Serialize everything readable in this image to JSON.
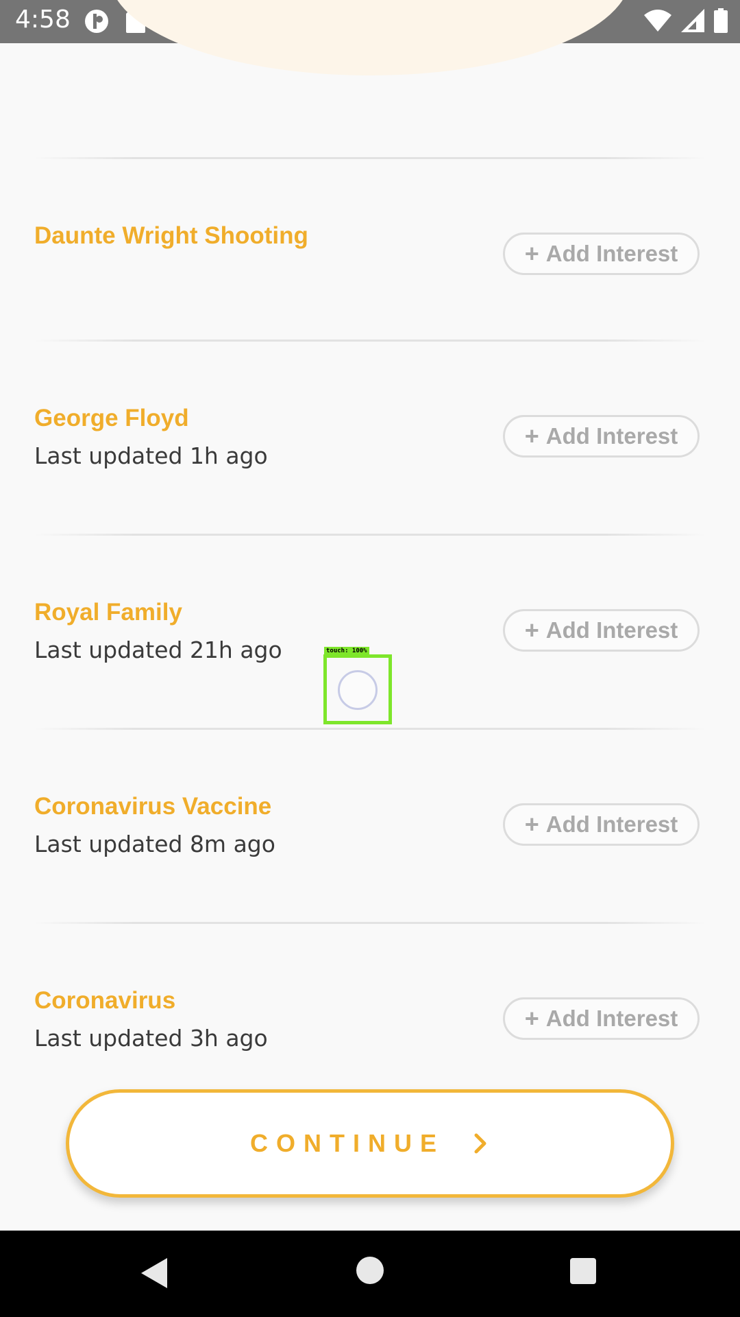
{
  "status_bar": {
    "time": "4:58",
    "icons": [
      "data-saver-icon",
      "sd-card-icon",
      "wifi-icon",
      "signal-icon",
      "battery-icon"
    ]
  },
  "interests": [
    {
      "title": "Daunte Wright Shooting",
      "subtitle": "",
      "button": "Add Interest"
    },
    {
      "title": "George Floyd",
      "subtitle": "Last updated 1h ago",
      "button": "Add Interest"
    },
    {
      "title": "Royal Family",
      "subtitle": "Last updated 21h ago",
      "button": "Add Interest"
    },
    {
      "title": "Coronavirus Vaccine",
      "subtitle": "Last updated 8m ago",
      "button": "Add Interest"
    },
    {
      "title": "Coronavirus",
      "subtitle": "Last updated 3h ago",
      "button": "Add Interest"
    }
  ],
  "add_button_plus": "+",
  "touch_overlay": {
    "label": "touch: 100%"
  },
  "continue_button": {
    "label": "CONTINUE"
  },
  "colors": {
    "accent": "#f0ad2b",
    "status_bar": "#757575",
    "background": "#f9f9f9",
    "nav_bar": "#000000"
  }
}
